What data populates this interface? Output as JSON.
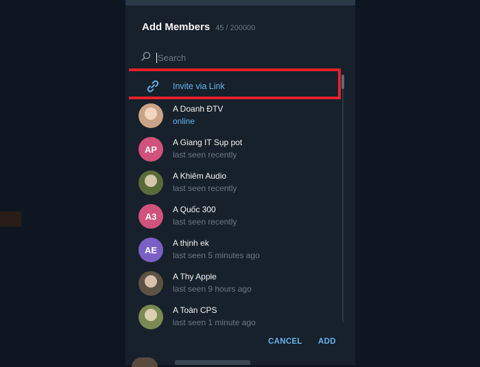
{
  "dialog": {
    "title": "Add Members",
    "count": "45 / 200000"
  },
  "search": {
    "placeholder": "Search",
    "value": "",
    "icon": "search-icon"
  },
  "invite": {
    "label": "Invite via Link",
    "icon": "link-icon",
    "color": "#64b5ef"
  },
  "highlight_color": "#e5222b",
  "members": [
    {
      "name": "A Doanh ĐTV",
      "status": "online",
      "avatar": {
        "type": "photo",
        "color": "#c9a486"
      }
    },
    {
      "name": "A Giang IT Sụp pot",
      "status": "last seen recently",
      "avatar": {
        "type": "initials",
        "initials": "AP",
        "color": "#d0527d"
      }
    },
    {
      "name": "A Khiêm Audio",
      "status": "last seen recently",
      "avatar": {
        "type": "photo",
        "color": "#5a6b3a"
      }
    },
    {
      "name": "A Quốc 300",
      "status": "last seen recently",
      "avatar": {
        "type": "initials",
        "initials": "A3",
        "color": "#d0527d"
      }
    },
    {
      "name": "A thịnh ek",
      "status": "last seen 5 minutes ago",
      "avatar": {
        "type": "initials",
        "initials": "AE",
        "color": "#7a5fc6"
      }
    },
    {
      "name": "A Thy Apple",
      "status": "last seen 9 hours ago",
      "avatar": {
        "type": "photo",
        "color": "#5c5345"
      }
    },
    {
      "name": "A Toàn CPS",
      "status": "last seen 1 minute ago",
      "avatar": {
        "type": "photo",
        "color": "#7a8a52"
      }
    }
  ],
  "footer": {
    "cancel_label": "CANCEL",
    "add_label": "ADD"
  }
}
